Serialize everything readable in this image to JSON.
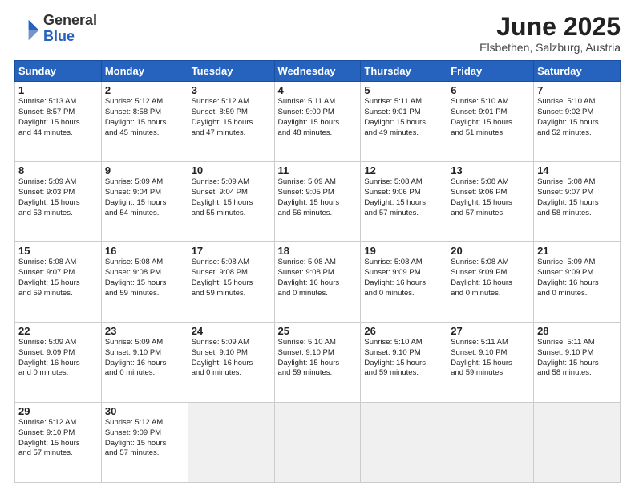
{
  "header": {
    "logo_general": "General",
    "logo_blue": "Blue",
    "month_year": "June 2025",
    "location": "Elsbethen, Salzburg, Austria"
  },
  "weekdays": [
    "Sunday",
    "Monday",
    "Tuesday",
    "Wednesday",
    "Thursday",
    "Friday",
    "Saturday"
  ],
  "days": [
    {
      "num": "",
      "info": ""
    },
    {
      "num": "",
      "info": ""
    },
    {
      "num": "",
      "info": ""
    },
    {
      "num": "",
      "info": ""
    },
    {
      "num": "",
      "info": ""
    },
    {
      "num": "",
      "info": ""
    },
    {
      "num": "",
      "info": ""
    },
    {
      "num": "1",
      "info": "Sunrise: 5:13 AM\nSunset: 8:57 PM\nDaylight: 15 hours\nand 44 minutes."
    },
    {
      "num": "2",
      "info": "Sunrise: 5:12 AM\nSunset: 8:58 PM\nDaylight: 15 hours\nand 45 minutes."
    },
    {
      "num": "3",
      "info": "Sunrise: 5:12 AM\nSunset: 8:59 PM\nDaylight: 15 hours\nand 47 minutes."
    },
    {
      "num": "4",
      "info": "Sunrise: 5:11 AM\nSunset: 9:00 PM\nDaylight: 15 hours\nand 48 minutes."
    },
    {
      "num": "5",
      "info": "Sunrise: 5:11 AM\nSunset: 9:01 PM\nDaylight: 15 hours\nand 49 minutes."
    },
    {
      "num": "6",
      "info": "Sunrise: 5:10 AM\nSunset: 9:01 PM\nDaylight: 15 hours\nand 51 minutes."
    },
    {
      "num": "7",
      "info": "Sunrise: 5:10 AM\nSunset: 9:02 PM\nDaylight: 15 hours\nand 52 minutes."
    },
    {
      "num": "8",
      "info": "Sunrise: 5:09 AM\nSunset: 9:03 PM\nDaylight: 15 hours\nand 53 minutes."
    },
    {
      "num": "9",
      "info": "Sunrise: 5:09 AM\nSunset: 9:04 PM\nDaylight: 15 hours\nand 54 minutes."
    },
    {
      "num": "10",
      "info": "Sunrise: 5:09 AM\nSunset: 9:04 PM\nDaylight: 15 hours\nand 55 minutes."
    },
    {
      "num": "11",
      "info": "Sunrise: 5:09 AM\nSunset: 9:05 PM\nDaylight: 15 hours\nand 56 minutes."
    },
    {
      "num": "12",
      "info": "Sunrise: 5:08 AM\nSunset: 9:06 PM\nDaylight: 15 hours\nand 57 minutes."
    },
    {
      "num": "13",
      "info": "Sunrise: 5:08 AM\nSunset: 9:06 PM\nDaylight: 15 hours\nand 57 minutes."
    },
    {
      "num": "14",
      "info": "Sunrise: 5:08 AM\nSunset: 9:07 PM\nDaylight: 15 hours\nand 58 minutes."
    },
    {
      "num": "15",
      "info": "Sunrise: 5:08 AM\nSunset: 9:07 PM\nDaylight: 15 hours\nand 59 minutes."
    },
    {
      "num": "16",
      "info": "Sunrise: 5:08 AM\nSunset: 9:08 PM\nDaylight: 15 hours\nand 59 minutes."
    },
    {
      "num": "17",
      "info": "Sunrise: 5:08 AM\nSunset: 9:08 PM\nDaylight: 15 hours\nand 59 minutes."
    },
    {
      "num": "18",
      "info": "Sunrise: 5:08 AM\nSunset: 9:08 PM\nDaylight: 16 hours\nand 0 minutes."
    },
    {
      "num": "19",
      "info": "Sunrise: 5:08 AM\nSunset: 9:09 PM\nDaylight: 16 hours\nand 0 minutes."
    },
    {
      "num": "20",
      "info": "Sunrise: 5:08 AM\nSunset: 9:09 PM\nDaylight: 16 hours\nand 0 minutes."
    },
    {
      "num": "21",
      "info": "Sunrise: 5:09 AM\nSunset: 9:09 PM\nDaylight: 16 hours\nand 0 minutes."
    },
    {
      "num": "22",
      "info": "Sunrise: 5:09 AM\nSunset: 9:09 PM\nDaylight: 16 hours\nand 0 minutes."
    },
    {
      "num": "23",
      "info": "Sunrise: 5:09 AM\nSunset: 9:10 PM\nDaylight: 16 hours\nand 0 minutes."
    },
    {
      "num": "24",
      "info": "Sunrise: 5:09 AM\nSunset: 9:10 PM\nDaylight: 16 hours\nand 0 minutes."
    },
    {
      "num": "25",
      "info": "Sunrise: 5:10 AM\nSunset: 9:10 PM\nDaylight: 15 hours\nand 59 minutes."
    },
    {
      "num": "26",
      "info": "Sunrise: 5:10 AM\nSunset: 9:10 PM\nDaylight: 15 hours\nand 59 minutes."
    },
    {
      "num": "27",
      "info": "Sunrise: 5:11 AM\nSunset: 9:10 PM\nDaylight: 15 hours\nand 59 minutes."
    },
    {
      "num": "28",
      "info": "Sunrise: 5:11 AM\nSunset: 9:10 PM\nDaylight: 15 hours\nand 58 minutes."
    },
    {
      "num": "29",
      "info": "Sunrise: 5:12 AM\nSunset: 9:10 PM\nDaylight: 15 hours\nand 57 minutes."
    },
    {
      "num": "30",
      "info": "Sunrise: 5:12 AM\nSunset: 9:09 PM\nDaylight: 15 hours\nand 57 minutes."
    },
    {
      "num": "",
      "info": ""
    },
    {
      "num": "",
      "info": ""
    },
    {
      "num": "",
      "info": ""
    },
    {
      "num": "",
      "info": ""
    },
    {
      "num": "",
      "info": ""
    }
  ]
}
